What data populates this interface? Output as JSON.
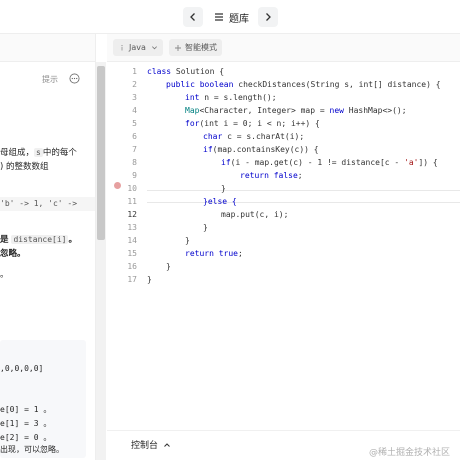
{
  "topbar": {
    "title": "题库"
  },
  "toolbar": {
    "language": "Java",
    "smart_mode": "智能模式"
  },
  "problem": {
    "hint_label": "提示",
    "lines": [
      "母组成，",
      "s",
      "中的每个",
      ") 的整数数组",
      "'b' -> 1, 'c' ->",
      "是",
      "distance[i]",
      "。",
      "忽略。",
      "。"
    ],
    "example_lines": [
      ",0,0,0,0]",
      "e[0] = 1 。",
      "e[1] = 3 。",
      "e[2] = 0 。",
      "出现，可以忽略。"
    ]
  },
  "editor": {
    "line_numbers": [
      "1",
      "2",
      "3",
      "4",
      "5",
      "6",
      "7",
      "8",
      "9",
      "10",
      "11",
      "12",
      "13",
      "14",
      "15",
      "16",
      "17"
    ],
    "active_line": "12",
    "code": {
      "l1a": "class ",
      "l1b": "Solution {",
      "l2a": "public boolean ",
      "l2b": "checkDistances(String s, int[] distance) {",
      "l3a": "int ",
      "l3b": "n = s.length();",
      "l4a": "Map",
      "l4b": "<Character, Integer> map = ",
      "l4c": "new ",
      "l4d": "HashMap<>();",
      "l5a": "for",
      "l5b": "(int i = 0; i < n; i++) {",
      "l6a": "char ",
      "l6b": "c = s.charAt(i);",
      "l7a": "if",
      "l7b": "(map.containsKey(c)) {",
      "l8a": "if",
      "l8b": "(i - map.get(c) - 1 != distance[c - ",
      "l8c": "'a'",
      "l8d": "]) {",
      "l9a": "return false",
      "l9b": ";",
      "l10": "}",
      "l11a": "}else {",
      "l12": "map.put(c, i);",
      "l13": "}",
      "l14": "}",
      "l15a": "return true",
      "l15b": ";",
      "l16": "}",
      "l17": "}"
    }
  },
  "bottom": {
    "console_label": "控制台",
    "watermark": "@稀土掘金技术社区"
  }
}
